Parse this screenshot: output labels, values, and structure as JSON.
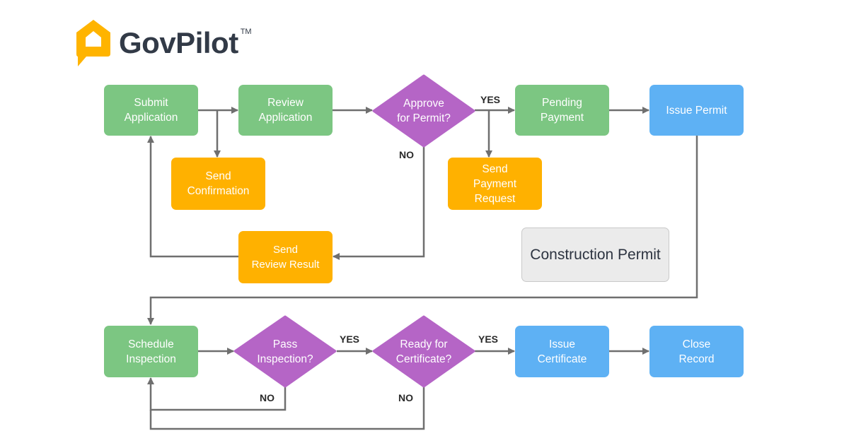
{
  "brand": {
    "name": "GovPilot",
    "trademark": "TM",
    "icon": "house-pin-icon",
    "color": "#ffb400"
  },
  "diagram": {
    "title": "Construction Permit",
    "colors": {
      "process": "#7cc682",
      "notification": "#ffb100",
      "decision": "#b565c6",
      "final": "#5eb1f4",
      "connector": "#6f6f6f"
    },
    "nodes": {
      "submit_application": "Submit\nApplication",
      "review_application": "Review\nApplication",
      "approve_for_permit": "Approve\nfor Permit?",
      "pending_payment": "Pending\nPayment",
      "issue_permit": "Issue Permit",
      "send_confirmation": "Send\nConfirmation",
      "send_payment_request": "Send\nPayment\nRequest",
      "send_review_result": "Send\nReview Result",
      "schedule_inspection": "Schedule\nInspection",
      "pass_inspection": "Pass\nInspection?",
      "ready_for_certificate": "Ready for\nCertificate?",
      "issue_certificate": "Issue\nCertificate",
      "close_record": "Close\nRecord"
    },
    "edge_labels": {
      "approve_yes": "YES",
      "approve_no": "NO",
      "pass_yes": "YES",
      "pass_no": "NO",
      "ready_yes": "YES",
      "ready_no": "NO"
    },
    "edges": [
      [
        "Submit Application",
        "Review Application"
      ],
      [
        "Submit Application",
        "Send Confirmation"
      ],
      [
        "Review Application",
        "Approve for Permit?"
      ],
      [
        "Approve for Permit?",
        "Pending Payment",
        "YES"
      ],
      [
        "Approve for Permit?",
        "Send Payment Request",
        "YES"
      ],
      [
        "Approve for Permit?",
        "Send Review Result",
        "NO"
      ],
      [
        "Send Review Result",
        "Submit Application"
      ],
      [
        "Pending Payment",
        "Issue Permit"
      ],
      [
        "Issue Permit",
        "Schedule Inspection"
      ],
      [
        "Schedule Inspection",
        "Pass Inspection?"
      ],
      [
        "Pass Inspection?",
        "Ready for Certificate?",
        "YES"
      ],
      [
        "Pass Inspection?",
        "Schedule Inspection",
        "NO"
      ],
      [
        "Ready for Certificate?",
        "Issue Certificate",
        "YES"
      ],
      [
        "Ready for Certificate?",
        "Schedule Inspection",
        "NO"
      ],
      [
        "Issue Certificate",
        "Close Record"
      ]
    ]
  }
}
